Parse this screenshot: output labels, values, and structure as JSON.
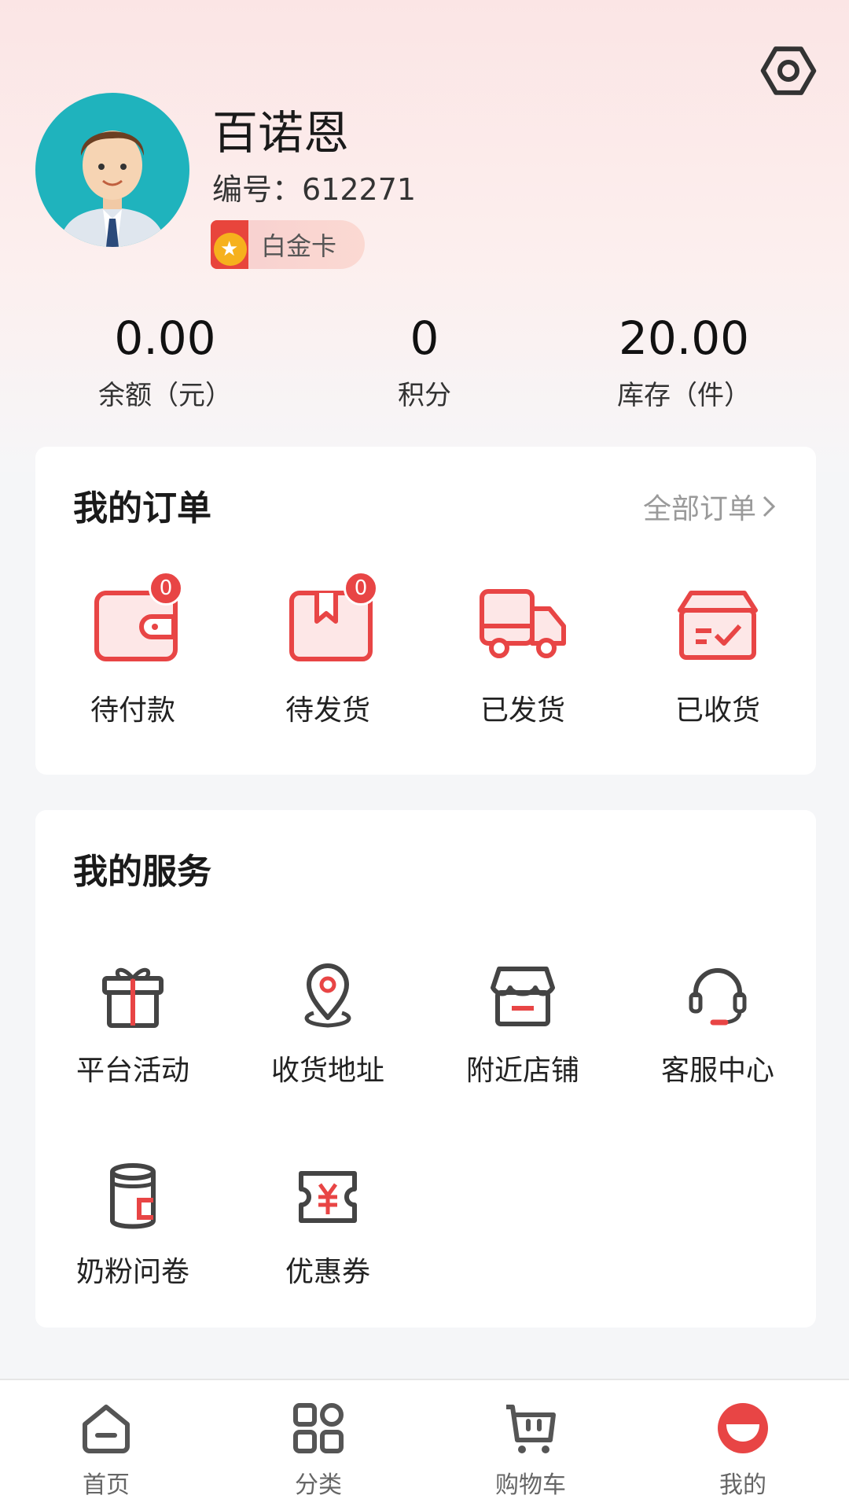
{
  "profile": {
    "name": "百诺恩",
    "id_label": "编号：",
    "id_value": "612271",
    "member_level": "白金卡"
  },
  "stats": [
    {
      "value": "0.00",
      "label": "余额（元）"
    },
    {
      "value": "0",
      "label": "积分"
    },
    {
      "value": "20.00",
      "label": "库存（件）"
    }
  ],
  "orders": {
    "title": "我的订单",
    "all_link": "全部订单",
    "items": [
      {
        "label": "待付款",
        "badge": "0",
        "icon": "wallet-icon"
      },
      {
        "label": "待发货",
        "badge": "0",
        "icon": "package-icon"
      },
      {
        "label": "已发货",
        "icon": "truck-icon"
      },
      {
        "label": "已收货",
        "icon": "received-box-icon"
      }
    ]
  },
  "services": {
    "title": "我的服务",
    "items": [
      {
        "label": "平台活动",
        "icon": "gift-icon"
      },
      {
        "label": "收货地址",
        "icon": "location-pin-icon"
      },
      {
        "label": "附近店铺",
        "icon": "store-icon"
      },
      {
        "label": "客服中心",
        "icon": "headset-icon"
      },
      {
        "label": "奶粉问卷",
        "icon": "milk-can-icon"
      },
      {
        "label": "优惠券",
        "icon": "coupon-icon"
      }
    ]
  },
  "tabbar": {
    "items": [
      {
        "label": "首页",
        "icon": "home-icon"
      },
      {
        "label": "分类",
        "icon": "category-icon"
      },
      {
        "label": "购物车",
        "icon": "cart-icon"
      },
      {
        "label": "我的",
        "icon": "profile-icon",
        "active": true
      }
    ]
  },
  "colors": {
    "accent": "#e84545",
    "icon_dark": "#444444",
    "badge": "#e84545",
    "avatar_bg": "#1fb3bd"
  }
}
